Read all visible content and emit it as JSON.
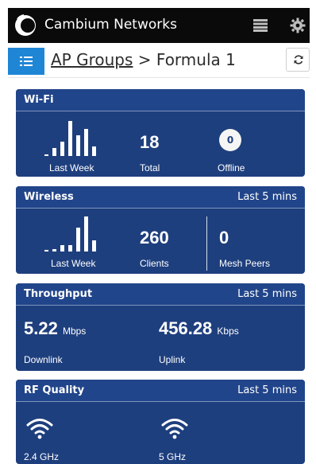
{
  "header": {
    "brand": "Cambium Networks",
    "icons": {
      "logo": "cambium-logo",
      "menu": "menu-icon",
      "settings": "gear-icon"
    }
  },
  "breadcrumb": {
    "parent": "AP Groups",
    "separator": " > ",
    "current": "Formula 1",
    "icons": {
      "nav": "list-icon",
      "refresh": "refresh-icon"
    }
  },
  "cards": {
    "wifi": {
      "title": "Wi-Fi",
      "chart_label": "Last Week",
      "total_value": "18",
      "total_label": "Total",
      "offline_value": "0",
      "offline_label": "Offline"
    },
    "wireless": {
      "title": "Wireless",
      "meta": "Last 5 mins",
      "chart_label": "Last Week",
      "clients_value": "260",
      "clients_label": "Clients",
      "mesh_value": "0",
      "mesh_label": "Mesh Peers"
    },
    "throughput": {
      "title": "Throughput",
      "meta": "Last 5 mins",
      "downlink_value": "5.22",
      "downlink_unit": "Mbps",
      "downlink_label": "Downlink",
      "uplink_value": "456.28",
      "uplink_unit": "Kbps",
      "uplink_label": "Uplink"
    },
    "rf": {
      "title": "RF Quality",
      "meta": "Last 5 mins",
      "band1_label": "2.4 GHz",
      "band2_label": "5 GHz"
    }
  }
}
